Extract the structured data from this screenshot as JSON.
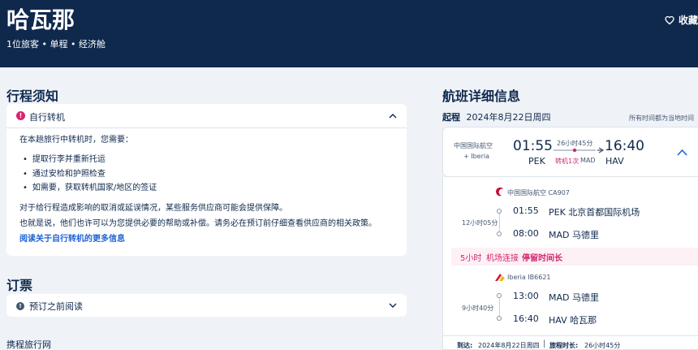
{
  "header": {
    "title": "哈瓦那",
    "subtitle": "1位旅客 • 单程 • 经济舱",
    "fav_label": "收藏"
  },
  "notice": {
    "section_title": "行程须知",
    "head_label": "自行转机",
    "intro": "在本趟旅行中转机时，您需要：",
    "bullets": [
      "提取行李并重新托运",
      "通过安检和护照检查",
      "如需要，获取转机国家/地区的签证"
    ],
    "para1": "对于给行程造成影响的取消或延误情况，某些服务供应商可能会提供保障。",
    "para2": "也就是说，他们也许可以为您提供必要的帮助或补偿。请务必在预订前仔细查看供应商的相关政策。",
    "link": "阅读关于自行转机的更多信息"
  },
  "booking": {
    "section_title": "订票",
    "read_label": "预订之前阅读"
  },
  "provider": "携程旅行网",
  "flight": {
    "section_title": "航班详细信息",
    "dep_label": "起程",
    "dep_date": "2024年8月22日周四",
    "tz_note": "所有时间都为当地时间",
    "summary": {
      "airline": "中国国际航空",
      "airline2": "+ Iberia",
      "dep_time": "01:55",
      "dep_code": "PEK",
      "duration": "26小时45分",
      "stops": "转机1次",
      "via": "MAD",
      "arr_time": "16:40",
      "arr_code": "HAV"
    },
    "segments": [
      {
        "carrier": "中国国际航空 CA907",
        "duration": "12小时05分",
        "dep_time": "01:55",
        "dep_place": "PEK 北京首都国际机场",
        "arr_time": "08:00",
        "arr_place": "MAD 马德里"
      },
      {
        "carrier": "Iberia IB6621",
        "duration": "9小时40分",
        "dep_time": "13:00",
        "dep_place": "MAD 马德里",
        "arr_time": "16:40",
        "arr_place": "HAV 哈瓦那"
      }
    ],
    "connection": {
      "duration": "5小时",
      "type": "机场连接",
      "label": "停留时间长"
    },
    "footer": {
      "arrive_label": "到达:",
      "arrive_date": "2024年8月22日周四",
      "trip_label": "旅程时长:",
      "trip_duration": "26小时45分"
    }
  },
  "colors": {
    "header_bg": "#0f294d",
    "accent_pink": "#d6246f",
    "link_blue": "#1d63d6",
    "page_bg": "#eff3f8"
  }
}
